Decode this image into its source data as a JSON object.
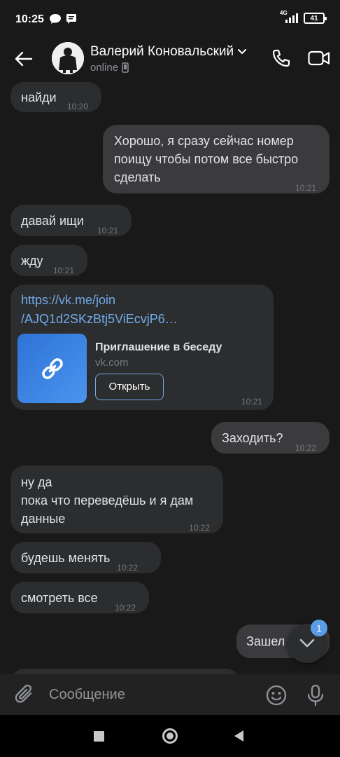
{
  "status_bar": {
    "time": "10:25",
    "network": "4G",
    "battery": "41"
  },
  "header": {
    "contact_name": "Валерий Коновальский",
    "status": "online"
  },
  "messages": [
    {
      "direction": "in",
      "lines": [
        "найди"
      ],
      "time": "10:20"
    },
    {
      "direction": "out",
      "lines": [
        "Хорошо, я сразу сейчас номер",
        "поищу чтобы потом все быстро",
        "сделать"
      ],
      "time": "10:21"
    },
    {
      "direction": "in",
      "lines": [
        "давай ищи"
      ],
      "time": "10:21"
    },
    {
      "direction": "in",
      "lines": [
        "жду"
      ],
      "time": "10:21"
    },
    {
      "direction": "in",
      "type": "link",
      "lines": [
        "https://vk.me/join",
        "/AJQ1d2SKzBtj5ViEcvjP6…"
      ],
      "card_title": "Приглашение в беседу",
      "card_domain": "vk.com",
      "card_button": "Открыть",
      "time": "10:21"
    },
    {
      "direction": "out",
      "lines": [
        "Заходить?"
      ],
      "time": "10:22"
    },
    {
      "direction": "in",
      "lines": [
        "ну да",
        "пока что переведёшь и я дам",
        "данные"
      ],
      "time": "10:22"
    },
    {
      "direction": "in",
      "lines": [
        "будешь менять"
      ],
      "time": "10:22"
    },
    {
      "direction": "in",
      "lines": [
        "смотреть все"
      ],
      "time": "10:22"
    },
    {
      "direction": "out",
      "lines": [
        "Зашел"
      ],
      "time": ""
    }
  ],
  "scroll_badge": "1",
  "composer": {
    "placeholder": "Сообщение"
  },
  "colors": {
    "background": "#19191a",
    "bubble_in": "#2c2d2e",
    "bubble_out": "#3b3b3d",
    "link": "#71aaeb",
    "badge": "#5a9de5"
  },
  "icons": [
    "arrow-left-icon",
    "phone-icon",
    "video-camera-icon",
    "chevron-down-icon",
    "paperclip-icon",
    "smile-icon",
    "microphone-icon",
    "link-icon",
    "mobile-phone-icon"
  ]
}
